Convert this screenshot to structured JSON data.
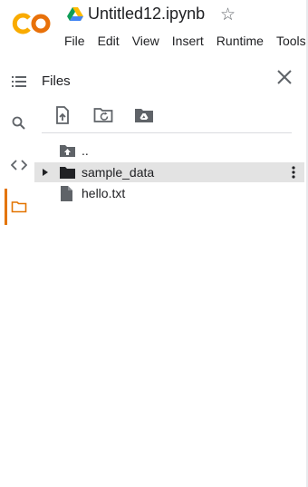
{
  "header": {
    "title": "Untitled12.ipynb",
    "logo_icon": "colab-logo",
    "drive_icon": "google-drive-icon",
    "star_icon": "star-outline-icon",
    "star_glyph": "☆",
    "menu": [
      "File",
      "Edit",
      "View",
      "Insert",
      "Runtime",
      "Tools"
    ]
  },
  "sidebar": {
    "items": [
      {
        "name": "table-of-contents",
        "icon": "list-icon",
        "active": false
      },
      {
        "name": "find",
        "icon": "search-icon",
        "active": false
      },
      {
        "name": "code-snippets",
        "icon": "code-icon",
        "active": false
      },
      {
        "name": "files",
        "icon": "folder-icon",
        "active": true
      }
    ],
    "active_color": "#e37400"
  },
  "files_panel": {
    "title": "Files",
    "toolbar": [
      "upload-file-icon",
      "refresh-folder-icon",
      "mount-drive-icon"
    ],
    "entries": [
      {
        "label": "..",
        "icon": "parent-folder-icon"
      },
      {
        "label": "sample_data",
        "icon": "folder-icon",
        "expandable": true,
        "selected": true
      },
      {
        "label": "hello.txt",
        "icon": "file-icon"
      }
    ]
  },
  "colors": {
    "logo_orange": "#f9ab00",
    "logo_dark_orange": "#e8710a",
    "selected_row": "#e3e3e3"
  }
}
